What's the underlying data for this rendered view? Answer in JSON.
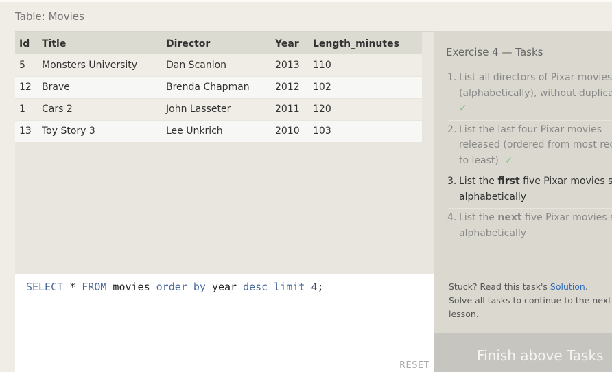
{
  "table_caption": "Table: Movies",
  "table": {
    "columns": [
      "Id",
      "Title",
      "Director",
      "Year",
      "Length_minutes"
    ],
    "rows": [
      [
        "5",
        "Monsters University",
        "Dan Scanlon",
        "2013",
        "110"
      ],
      [
        "12",
        "Brave",
        "Brenda Chapman",
        "2012",
        "102"
      ],
      [
        "1",
        "Cars 2",
        "John Lasseter",
        "2011",
        "120"
      ],
      [
        "13",
        "Toy Story 3",
        "Lee Unkrich",
        "2010",
        "103"
      ]
    ]
  },
  "editor": {
    "query": "SELECT * FROM movies order by year desc limit 4;",
    "reset_label": "RESET"
  },
  "tasks": {
    "title": "Exercise 4 — Tasks",
    "items": [
      {
        "num": "1.",
        "lines": [
          "List all directors of Pixar movies",
          "(alphabetically), without duplicates"
        ],
        "check": "✓"
      },
      {
        "num": "2.",
        "lines": [
          "List the last four Pixar movies",
          "released (ordered from most recent",
          "to least)"
        ],
        "check": "✓"
      },
      {
        "num": "3.",
        "pre": "List the ",
        "bold": "first",
        "post": " five Pixar movies sorted",
        "line2": "alphabetically"
      },
      {
        "num": "4.",
        "pre": "List the ",
        "bold": "next",
        "post": " five Pixar movies sorted",
        "line2": "alphabetically"
      }
    ]
  },
  "stuck": {
    "prefix": "Stuck? Read this task's ",
    "link": "Solution",
    "suffix": ".",
    "line2": "Solve all tasks to continue to the next lesson."
  },
  "finish_label": "Finish above Tasks",
  "colors": {
    "background": "#efede6",
    "tasks_panel": "#dbd9cf",
    "link": "#2f6db8",
    "check": "#8fc08f",
    "finish_button": "#c6c5c0"
  }
}
